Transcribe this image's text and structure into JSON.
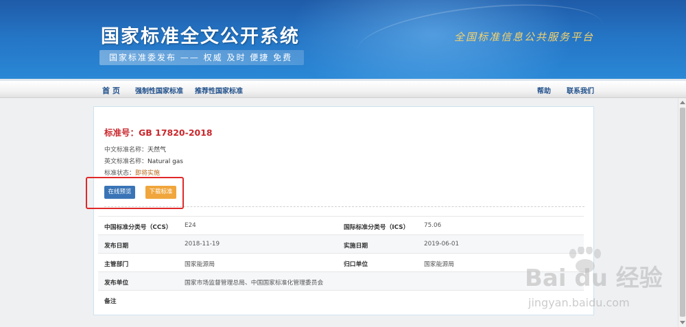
{
  "header": {
    "site_title": "国家标准全文公开系统",
    "slogan": "国家标准委发布 —— 权威 及时 便捷 免费",
    "platform": "全国标准信息公共服务平台"
  },
  "nav": {
    "home": "首 页",
    "mandatory": "强制性国家标准",
    "recommended": "推荐性国家标准",
    "help": "帮助",
    "contact": "联系我们"
  },
  "standard": {
    "code_label": "标准号：GB 17820-2018",
    "cn_name_label": "中文标准名称：",
    "cn_name": "天然气",
    "en_name_label": "英文标准名称：",
    "en_name": "Natural gas",
    "status_label": "标准状态：",
    "status": "即将实施"
  },
  "buttons": {
    "preview": "在线预览",
    "download": "下载标准"
  },
  "meta": {
    "ccs_label": "中国标准分类号（CCS）",
    "ccs": "E24",
    "ics_label": "国际标准分类号（ICS）",
    "ics": "75.06",
    "publish_date_label": "发布日期",
    "publish_date": "2018-11-19",
    "impl_date_label": "实施日期",
    "impl_date": "2019-06-01",
    "dept_label": "主管部门",
    "dept": "国家能源局",
    "owner_label": "归口单位",
    "owner": "国家能源局",
    "issuer_label": "发布单位",
    "issuer": "国家市场监督管理总局、中国国家标准化管理委员会",
    "note_label": "备注",
    "note": ""
  },
  "watermark": {
    "brand": "Bai du 经验",
    "url": "jingyan.baidu.com"
  },
  "colors": {
    "banner_blue": "#2474c4",
    "title_red": "#c9282d",
    "preview_btn": "#3a74b6",
    "download_btn": "#f0a63c",
    "highlight": "#e02828"
  }
}
